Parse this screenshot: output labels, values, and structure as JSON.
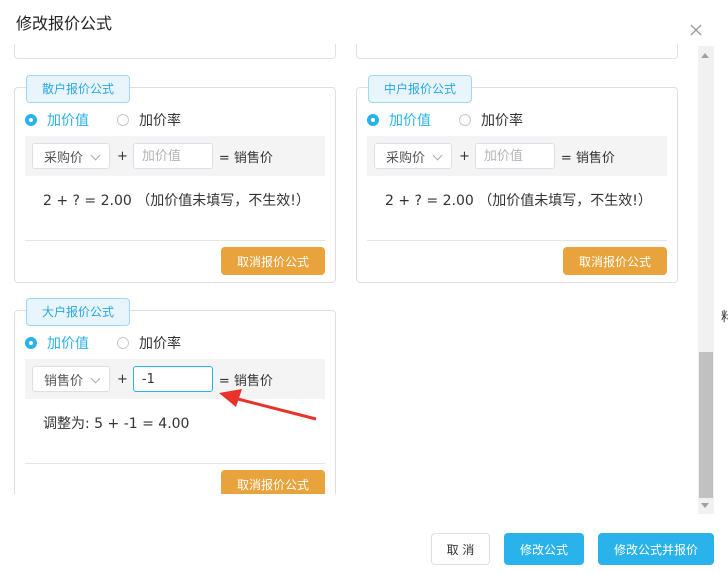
{
  "dialog": {
    "title": "修改报价公式",
    "close_icon": "close-icon"
  },
  "cards": [
    {
      "tag": "散户报价公式",
      "radio_options": [
        "加价值",
        "加价率"
      ],
      "selected_option": "加价值",
      "base_select": "采购价",
      "plus": "+",
      "input_value": "",
      "input_placeholder": "加价值",
      "equals_label": "= 销售价",
      "result": "2 + ? = 2.00 （加价值未填写，不生效!）",
      "cancel_button": "取消报价公式"
    },
    {
      "tag": "中户报价公式",
      "radio_options": [
        "加价值",
        "加价率"
      ],
      "selected_option": "加价值",
      "base_select": "采购价",
      "plus": "+",
      "input_value": "",
      "input_placeholder": "加价值",
      "equals_label": "= 销售价",
      "result": "2 + ? = 2.00 （加价值未填写，不生效!）",
      "cancel_button": "取消报价公式"
    },
    {
      "tag": "大户报价公式",
      "radio_options": [
        "加价值",
        "加价率"
      ],
      "selected_option": "加价值",
      "base_select": "销售价",
      "plus": "+",
      "input_value": "-1",
      "input_placeholder": "加价值",
      "equals_label": "= 销售价",
      "result": "调整为: 5 + -1 = 4.00",
      "cancel_button": "取消报价公式"
    }
  ],
  "footer": {
    "cancel": "取 消",
    "modify": "修改公式",
    "modify_and_quote": "修改公式并报价"
  },
  "colors": {
    "accent": "#2ab2ea",
    "warning": "#e8a33c",
    "annotation_arrow": "#e8322a"
  },
  "background_edge_text": "料"
}
